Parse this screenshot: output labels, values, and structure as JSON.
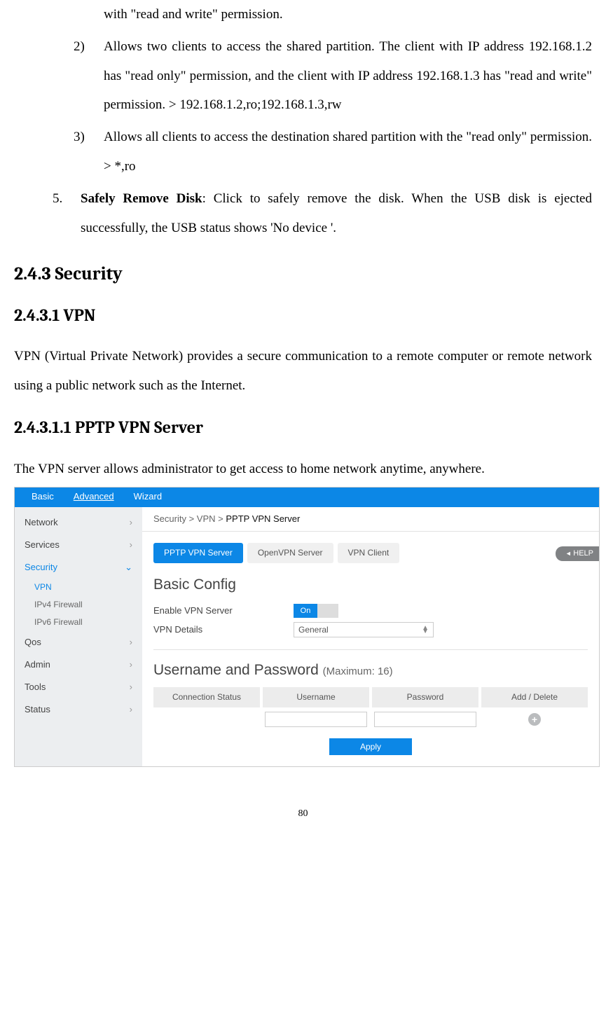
{
  "frag0": "with \"read and write\" permission.",
  "item2_marker": "2)",
  "item2_text": "Allows two clients to access the shared partition. The client with IP address 192.168.1.2 has \"read only\" permission, and the client with IP address 192.168.1.3 has \"read and write\" permission. > 192.168.1.2,ro;192.168.1.3,rw",
  "item3_marker": "3)",
  "item3_text": "Allows all clients to access the destination shared partition with the \"read only\" permission. > *,ro",
  "item5_marker": "5.",
  "item5_bold": "Safely Remove Disk",
  "item5_rest": ": Click to safely remove the disk. When the USB disk is ejected successfully, the USB status shows 'No device '.",
  "h243": "2.4.3 Security",
  "h2431": "2.4.3.1 VPN",
  "vpn_para": "VPN (Virtual Private Network) provides a secure communication to a remote computer or remote network using a public network such as the Internet.",
  "h24311": "2.4.3.1.1 PPTP VPN Server",
  "pptp_para": "The VPN server allows administrator to get access to home network anytime, anywhere.",
  "ui": {
    "topnav": {
      "basic": "Basic",
      "advanced": "Advanced",
      "wizard": "Wizard"
    },
    "sidebar": {
      "network": "Network",
      "services": "Services",
      "security": "Security",
      "vpn": "VPN",
      "ipv4fw": "IPv4 Firewall",
      "ipv6fw": "IPv6 Firewall",
      "qos": "Qos",
      "admin": "Admin",
      "tools": "Tools",
      "status": "Status"
    },
    "breadcrumb": {
      "a": "Security",
      "b": "VPN",
      "c": "PPTP VPN Server"
    },
    "help": "HELP",
    "tabs": {
      "pptp": "PPTP VPN Server",
      "openvpn": "OpenVPN Server",
      "client": "VPN Client"
    },
    "basic_config": "Basic Config",
    "enable_label": "Enable VPN Server",
    "on": "On",
    "details_label": "VPN Details",
    "details_value": "General",
    "userpw_title": "Username and Password",
    "userpw_sub": "(Maximum: 16)",
    "hdr": {
      "conn": "Connection Status",
      "user": "Username",
      "pass": "Password",
      "add": "Add / Delete"
    },
    "apply": "Apply"
  },
  "page_number": "80"
}
